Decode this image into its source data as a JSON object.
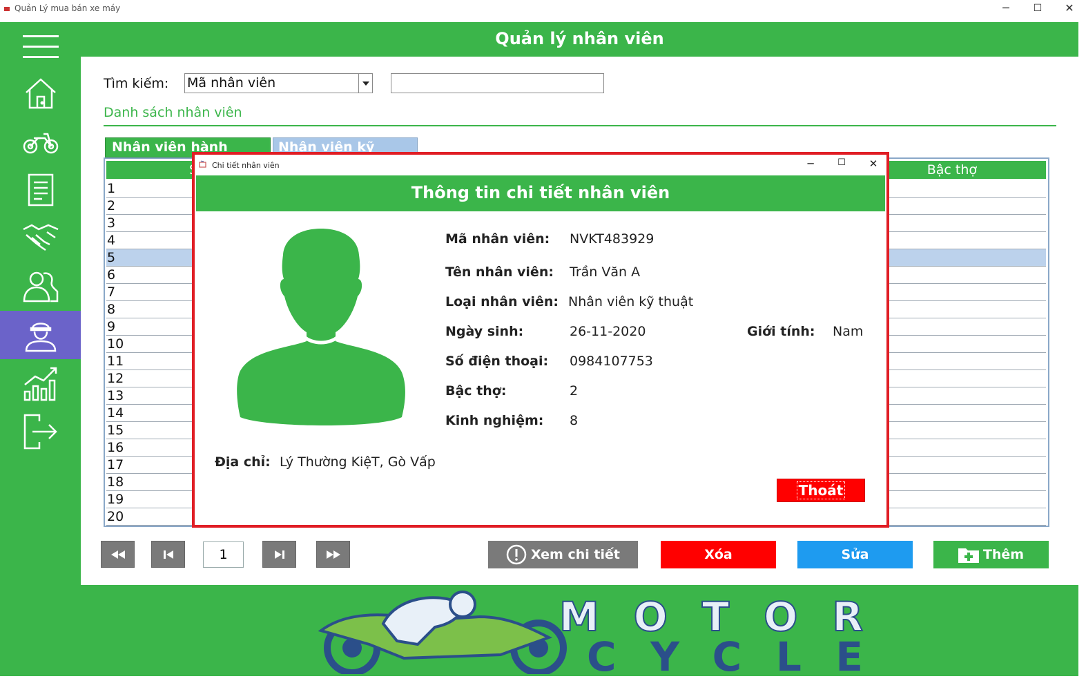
{
  "window": {
    "title": "Quản Lý mua bán xe máy",
    "minimize_glyph": "─",
    "maximize_glyph": "☐",
    "close_glyph": "✕"
  },
  "sidebar": {
    "items": [
      {
        "name": "menu-icon"
      },
      {
        "name": "home-icon"
      },
      {
        "name": "motorcycle-icon"
      },
      {
        "name": "invoice-icon"
      },
      {
        "name": "handshake-icon"
      },
      {
        "name": "customers-icon"
      },
      {
        "name": "employee-icon",
        "active": true
      },
      {
        "name": "statistics-icon"
      },
      {
        "name": "logout-icon"
      }
    ],
    "active_color": "#6b63c9"
  },
  "header": {
    "title": "Quản lý nhân viên"
  },
  "search": {
    "label": "Tìm kiếm:",
    "selected_option": "Mã nhân viên",
    "input_value": ""
  },
  "list": {
    "title": "Danh sách nhân viên",
    "tabs": [
      "Nhân viên hành chính",
      "Nhân viên kỹ thuật"
    ],
    "visible_header_left": "S",
    "visible_header_right": "Bậc thợ",
    "rows": [
      "1",
      "2",
      "3",
      "4",
      "5",
      "6",
      "7",
      "8",
      "9",
      "10",
      "11",
      "12",
      "13",
      "14",
      "15",
      "16",
      "17",
      "18",
      "19",
      "20"
    ],
    "selected_row": 5
  },
  "pagination": {
    "page": "1"
  },
  "actions": {
    "view_label": "Xem chi tiết",
    "delete_label": "Xóa",
    "edit_label": "Sửa",
    "add_label": "Thêm"
  },
  "colors": {
    "green": "#3bb54a",
    "red": "#ff0000",
    "blue": "#1e9bf0",
    "gray": "#7a7a7a",
    "selection": "#bcd2ec"
  },
  "dialog": {
    "window_title": "Chi tiết nhân viên",
    "heading": "Thông tin chi tiết nhân viên",
    "fields": {
      "ma_label": "Mã nhân viên:",
      "ma_value": "NVKT483929",
      "ten_label": "Tên nhân viên:",
      "ten_value": "Trần Văn A",
      "loai_label": "Loại nhân viên:",
      "loai_value": "Nhân viên kỹ thuật",
      "ngaysinh_label": "Ngày sinh:",
      "ngaysinh_value": "26-11-2020",
      "gioitinh_label": "Giới tính:",
      "gioitinh_value": "Nam",
      "sdt_label": "Số điện thoại:",
      "sdt_value": "0984107753",
      "bactho_label": "Bậc thợ:",
      "bactho_value": "2",
      "kinhnghiem_label": "Kinh nghiệm:",
      "kinhnghiem_value": "8",
      "diachi_label": "Địa chỉ:",
      "diachi_value": "Lý Thường KiệT, Gò Vấp"
    },
    "exit_label": "Thoát"
  },
  "logo": {
    "line1": "MOTOR",
    "line2": "CYCLE"
  }
}
